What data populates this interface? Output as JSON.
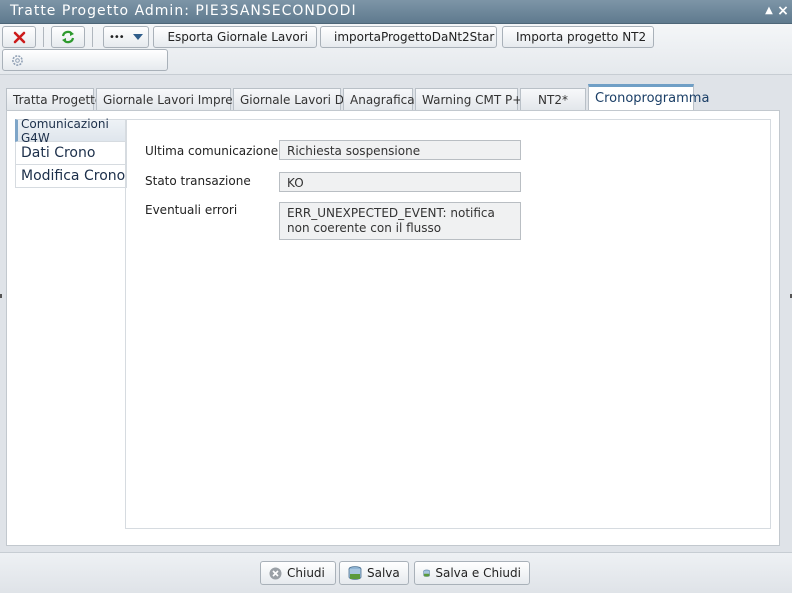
{
  "window": {
    "title": "Tratte Progetto Admin: PIE3SANSECONDODI"
  },
  "toolbar": {
    "more_label": "•••",
    "esporta_label": "Esporta Giornale Lavori",
    "importa_nt2star_label": "importaProgettoDaNt2Star",
    "importa_nt2_label": "Importa progetto NT2",
    "extra_label": ""
  },
  "tabs": [
    {
      "label": "Tratta Progetto"
    },
    {
      "label": "Giornale Lavori Impresa"
    },
    {
      "label": "Giornale Lavori DL"
    },
    {
      "label": "Anagrafica"
    },
    {
      "label": "Warning CMT P+"
    },
    {
      "label": "NT2*"
    },
    {
      "label": "Cronoprogramma"
    }
  ],
  "sidenav": [
    {
      "label": "Comunicazioni G4W"
    },
    {
      "label": "Dati Crono"
    },
    {
      "label": "Modifica Crono"
    }
  ],
  "form": {
    "ultima": {
      "label": "Ultima comunicazione",
      "value": "Richiesta sospensione"
    },
    "stato": {
      "label": "Stato transazione",
      "value": "KO"
    },
    "errori": {
      "label": "Eventuali errori",
      "value": "ERR_UNEXPECTED_EVENT: notifica non coerente con il flusso"
    }
  },
  "footer": {
    "chiudi_label": "Chiudi",
    "salva_label": "Salva",
    "salva_chiudi_label": "Salva e Chiudi"
  },
  "colors": {
    "titlebar": "#6a8598",
    "accent": "#6f9fc6",
    "close_red": "#cc1b1b",
    "refresh_green": "#2e9a2e"
  }
}
